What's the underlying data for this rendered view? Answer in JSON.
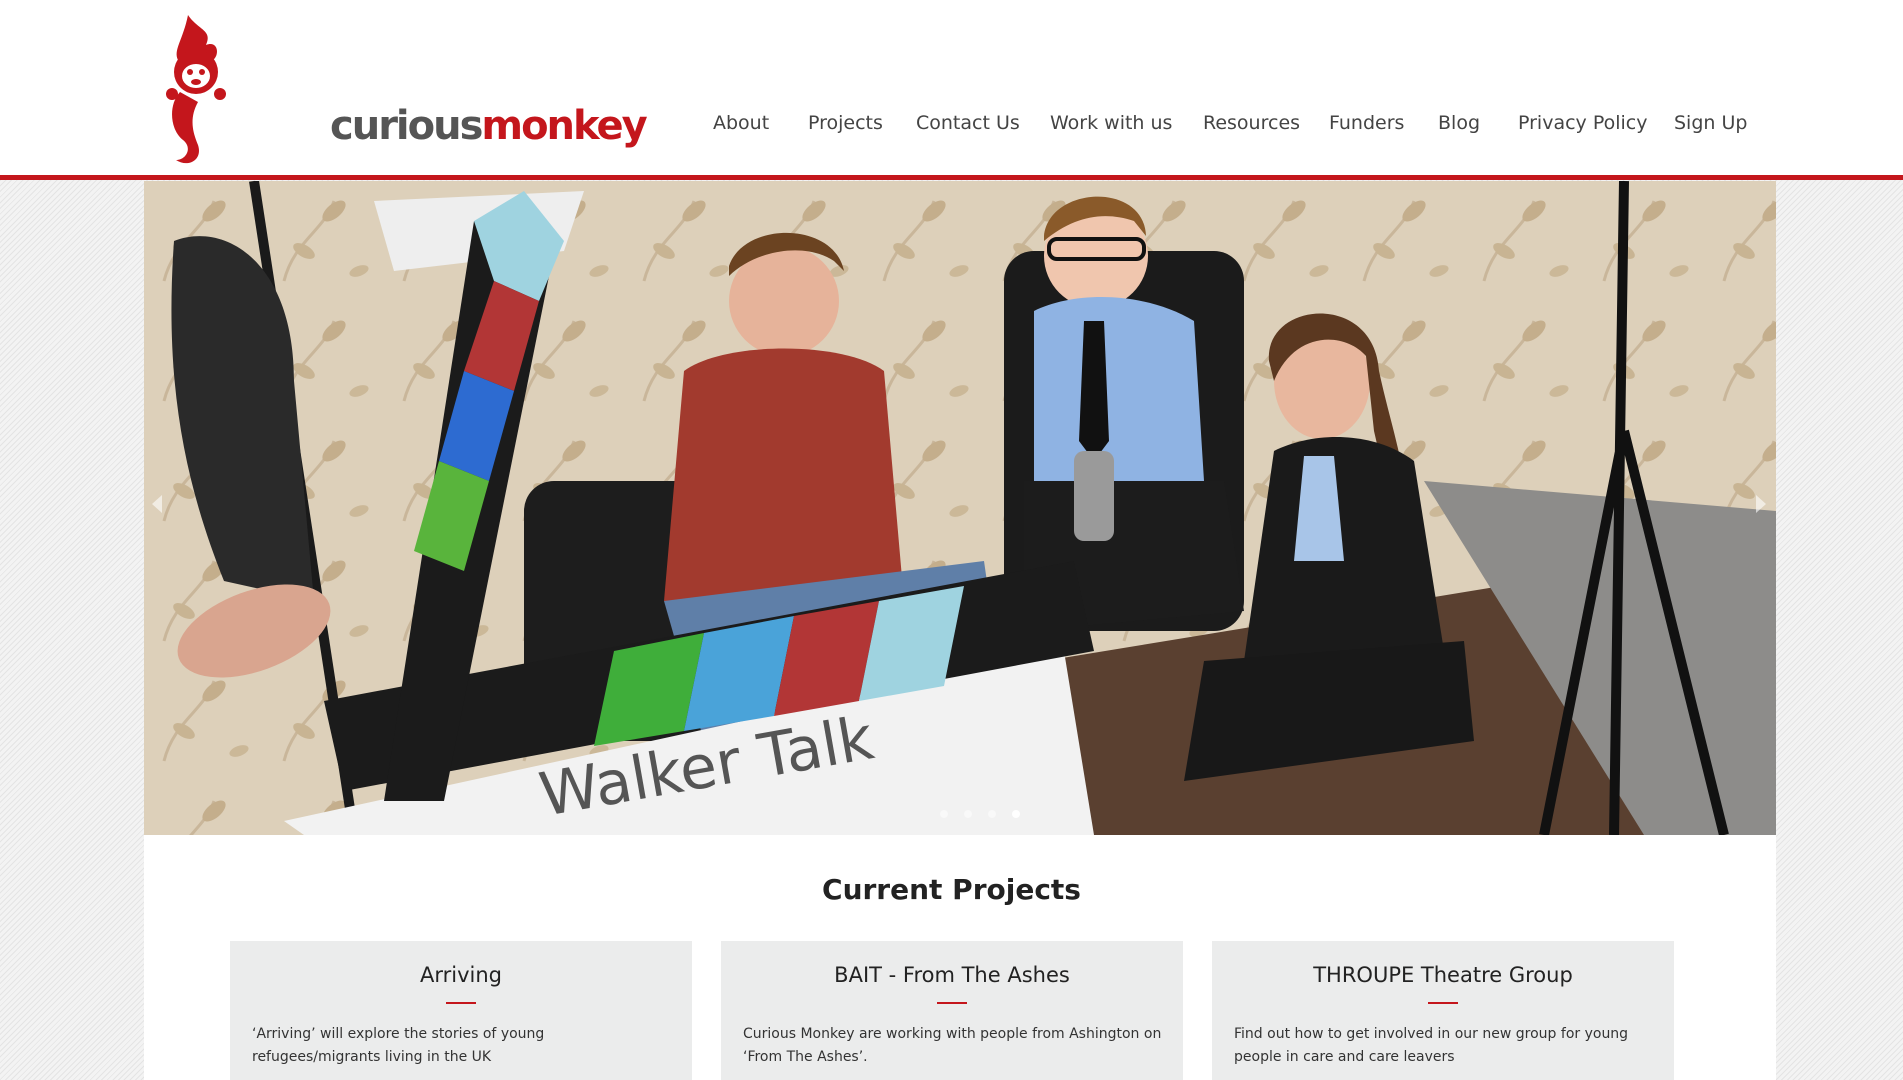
{
  "brand": {
    "logo_part1": "curious",
    "logo_part2": "monkey",
    "accent_color": "#c4161c"
  },
  "nav": {
    "items": [
      {
        "label": "About"
      },
      {
        "label": "Projects"
      },
      {
        "label": "Contact Us"
      },
      {
        "label": "Work with us"
      },
      {
        "label": "Resources"
      },
      {
        "label": "Funders"
      },
      {
        "label": "Blog"
      },
      {
        "label": "Privacy Policy"
      },
      {
        "label": "Sign Up"
      }
    ]
  },
  "carousel": {
    "slide_count": 4,
    "active_slide": 4,
    "clapper_text": "Walker Talk",
    "prev_icon": "chevron-left-icon",
    "next_icon": "chevron-right-icon"
  },
  "section": {
    "title": "Current Projects"
  },
  "projects": [
    {
      "title": "Arriving",
      "description": "‘Arriving’ will explore the stories of young refugees/migrants living in the UK"
    },
    {
      "title": "BAIT - From The Ashes",
      "description": "Curious Monkey are working with people from Ashington on ‘From The Ashes’."
    },
    {
      "title": "THROUPE Theatre Group",
      "description": "Find out how to get involved in our new group for young people in care and care leavers"
    }
  ]
}
